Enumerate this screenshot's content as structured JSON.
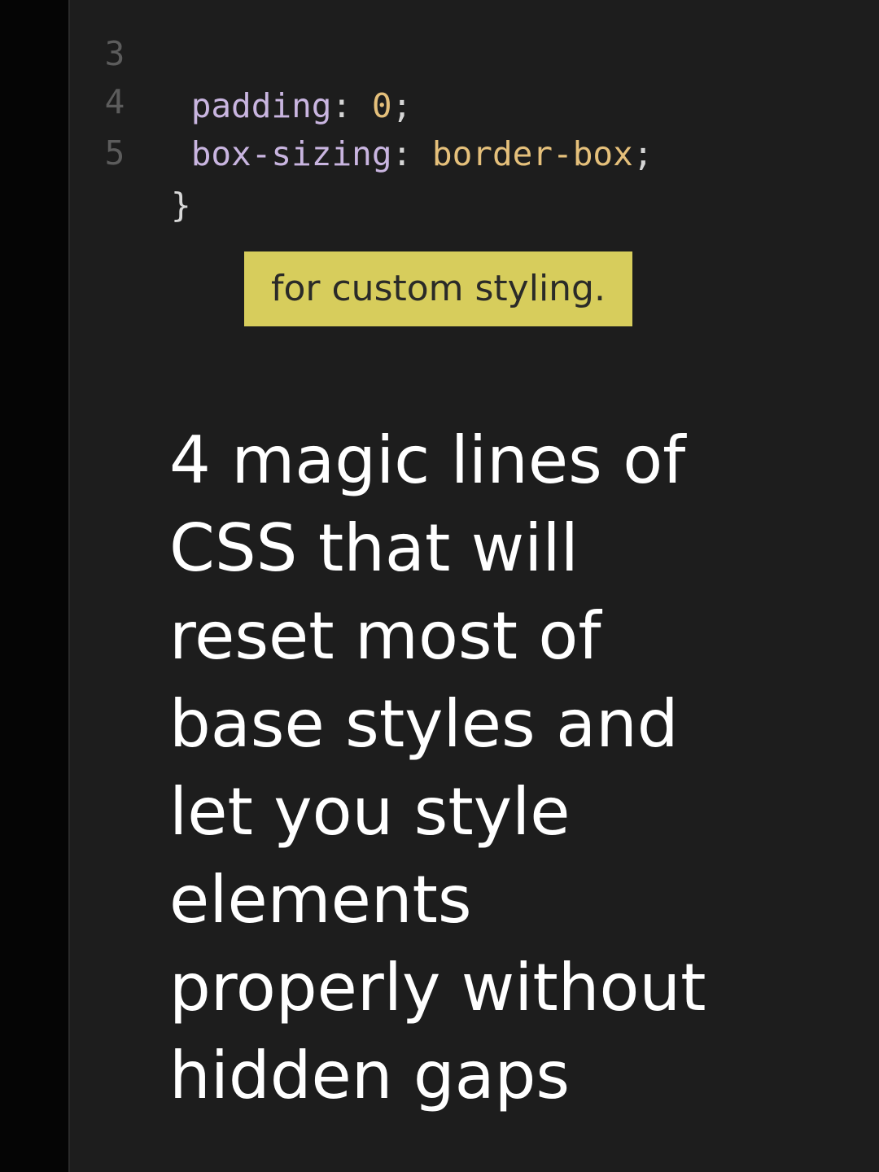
{
  "code_editor": {
    "lines": [
      {
        "number": "3",
        "property": "padding",
        "colon": ":",
        "value": "0",
        "terminator": ";"
      },
      {
        "number": "4",
        "property": "box-sizing",
        "colon": ":",
        "value": "border-box",
        "terminator": ";"
      },
      {
        "number": "5",
        "brace": "}"
      }
    ],
    "colors": {
      "background": "#1d1d1d",
      "gutter": "#050505",
      "property": "#c9b5e0",
      "value": "#e5c07b",
      "line_number": "#5c5c5c"
    }
  },
  "caption": {
    "text": "for custom styling.",
    "background": "#d7cd5c"
  },
  "headline": {
    "lines": [
      "4 magic lines of",
      "CSS that will",
      "reset most of",
      "base styles and",
      "let you style",
      "elements",
      "properly without",
      "hidden gaps"
    ]
  }
}
